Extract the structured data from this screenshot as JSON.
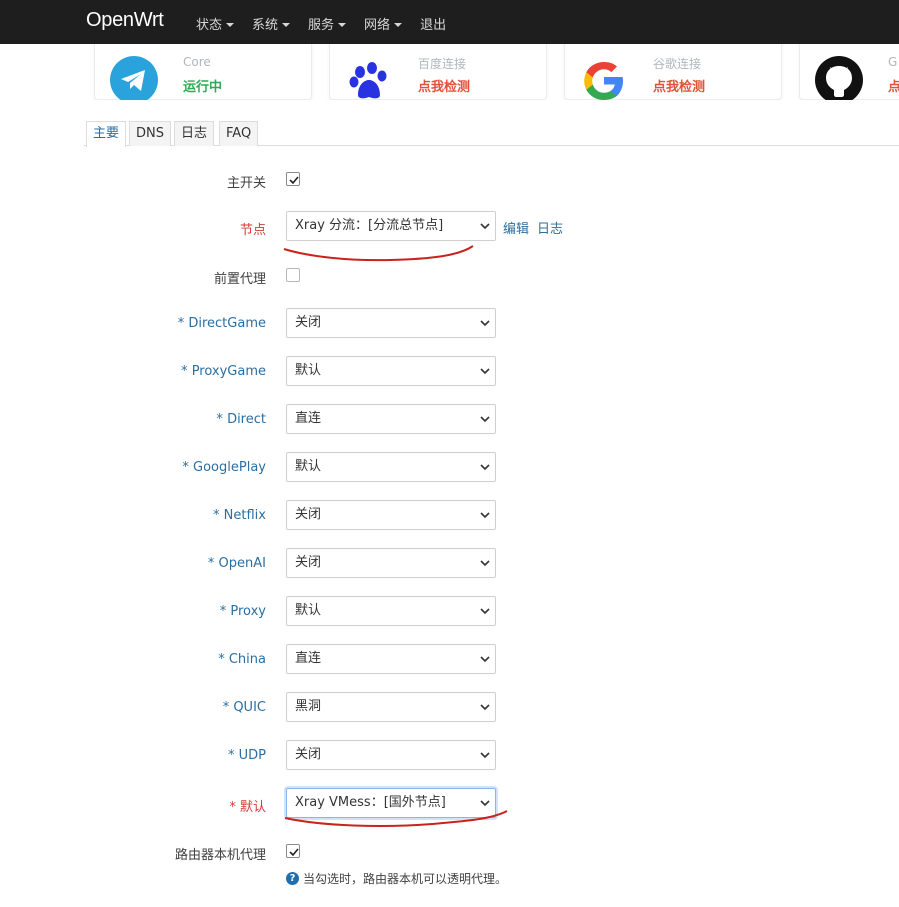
{
  "nav": {
    "brand": "OpenWrt",
    "menu": [
      {
        "label": "状态",
        "dropdown": true
      },
      {
        "label": "系统",
        "dropdown": true
      },
      {
        "label": "服务",
        "dropdown": true
      },
      {
        "label": "网络",
        "dropdown": true
      },
      {
        "label": "退出",
        "dropdown": false
      }
    ]
  },
  "cards": [
    {
      "name": "Core",
      "status": "运行中",
      "status_color": "#2eaa52",
      "icon": "telegram-icon"
    },
    {
      "name": "百度连接",
      "status": "点我检测",
      "status_color": "#e0533a",
      "icon": "baidu-paw-icon"
    },
    {
      "name": "谷歌连接",
      "status": "点我检测",
      "status_color": "#e0533a",
      "icon": "google-icon"
    },
    {
      "name": "G",
      "status": "点",
      "status_color": "#e0533a",
      "icon": "github-icon"
    }
  ],
  "tabs": [
    "主要",
    "DNS",
    "日志",
    "FAQ"
  ],
  "form": {
    "main_switch_label": "主开关",
    "node_label": "节点",
    "node_value": "Xray 分流：[分流总节点]",
    "edit_link": "编辑",
    "log_link": "日志",
    "pre_proxy_label": "前置代理",
    "rules": [
      {
        "label": "DirectGame",
        "value": "关闭"
      },
      {
        "label": "ProxyGame",
        "value": "默认"
      },
      {
        "label": "Direct",
        "value": "直连"
      },
      {
        "label": "GooglePlay",
        "value": "默认"
      },
      {
        "label": "Netflix",
        "value": "关闭"
      },
      {
        "label": "OpenAI",
        "value": "关闭"
      },
      {
        "label": "Proxy",
        "value": "默认"
      },
      {
        "label": "China",
        "value": "直连"
      },
      {
        "label": "QUIC",
        "value": "黑洞"
      },
      {
        "label": "UDP",
        "value": "关闭"
      }
    ],
    "default_label": "默认",
    "default_value": "Xray VMess：[国外节点]",
    "localhost_label": "路由器本机代理",
    "hint": "当勾选时，路由器本机可以透明代理。",
    "required_mark": "* "
  },
  "colors": {
    "navbar": "#1e1e1e",
    "link": "#2b6ea0",
    "required_red": "#d43a3a",
    "annotation_red": "#c8231f"
  }
}
